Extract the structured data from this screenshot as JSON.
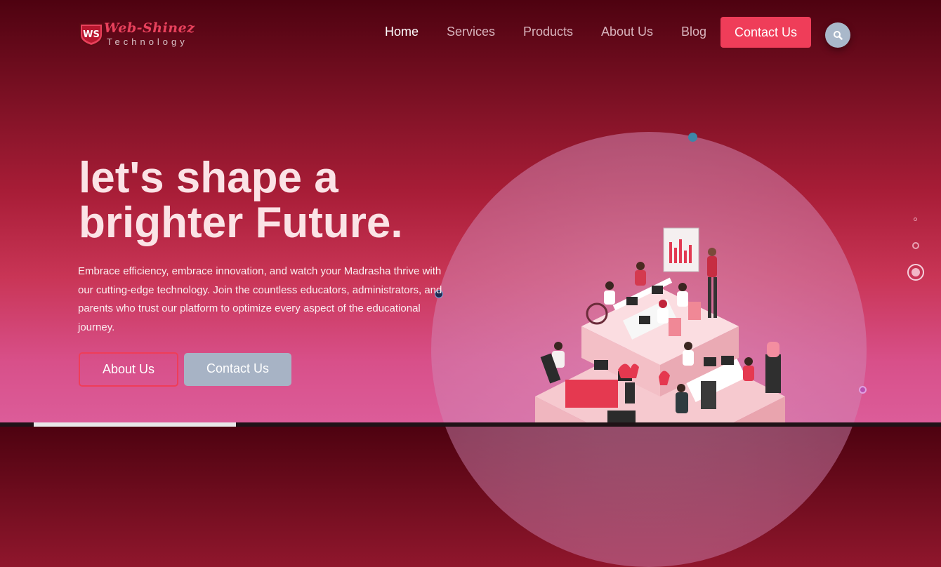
{
  "brand": {
    "badge": "WS",
    "name": "Web-Shinez",
    "tagline": "Technology"
  },
  "nav": {
    "items": [
      {
        "label": "Home",
        "active": true
      },
      {
        "label": "Services",
        "active": false
      },
      {
        "label": "Products",
        "active": false
      },
      {
        "label": "About Us",
        "active": false
      },
      {
        "label": "Blog",
        "active": false
      }
    ],
    "cta_label": "Contact Us",
    "search_icon": "search-icon"
  },
  "hero": {
    "title_line1": "let's shape a",
    "title_line2": "brighter Future.",
    "description": "Embrace efficiency, embrace innovation, and watch your Madrasha thrive with our cutting-edge technology. Join the countless educators, administrators, and parents who trust our platform to optimize every aspect of the educational journey.",
    "primary_button": "About Us",
    "secondary_button": "Contact Us"
  },
  "colors": {
    "accent": "#ef3d59",
    "secondary_button": "#a7b3c5",
    "bg_top": "#4e0210",
    "bg_bottom": "#dc5d9a"
  },
  "illustration": "isometric-office-team-illustration"
}
